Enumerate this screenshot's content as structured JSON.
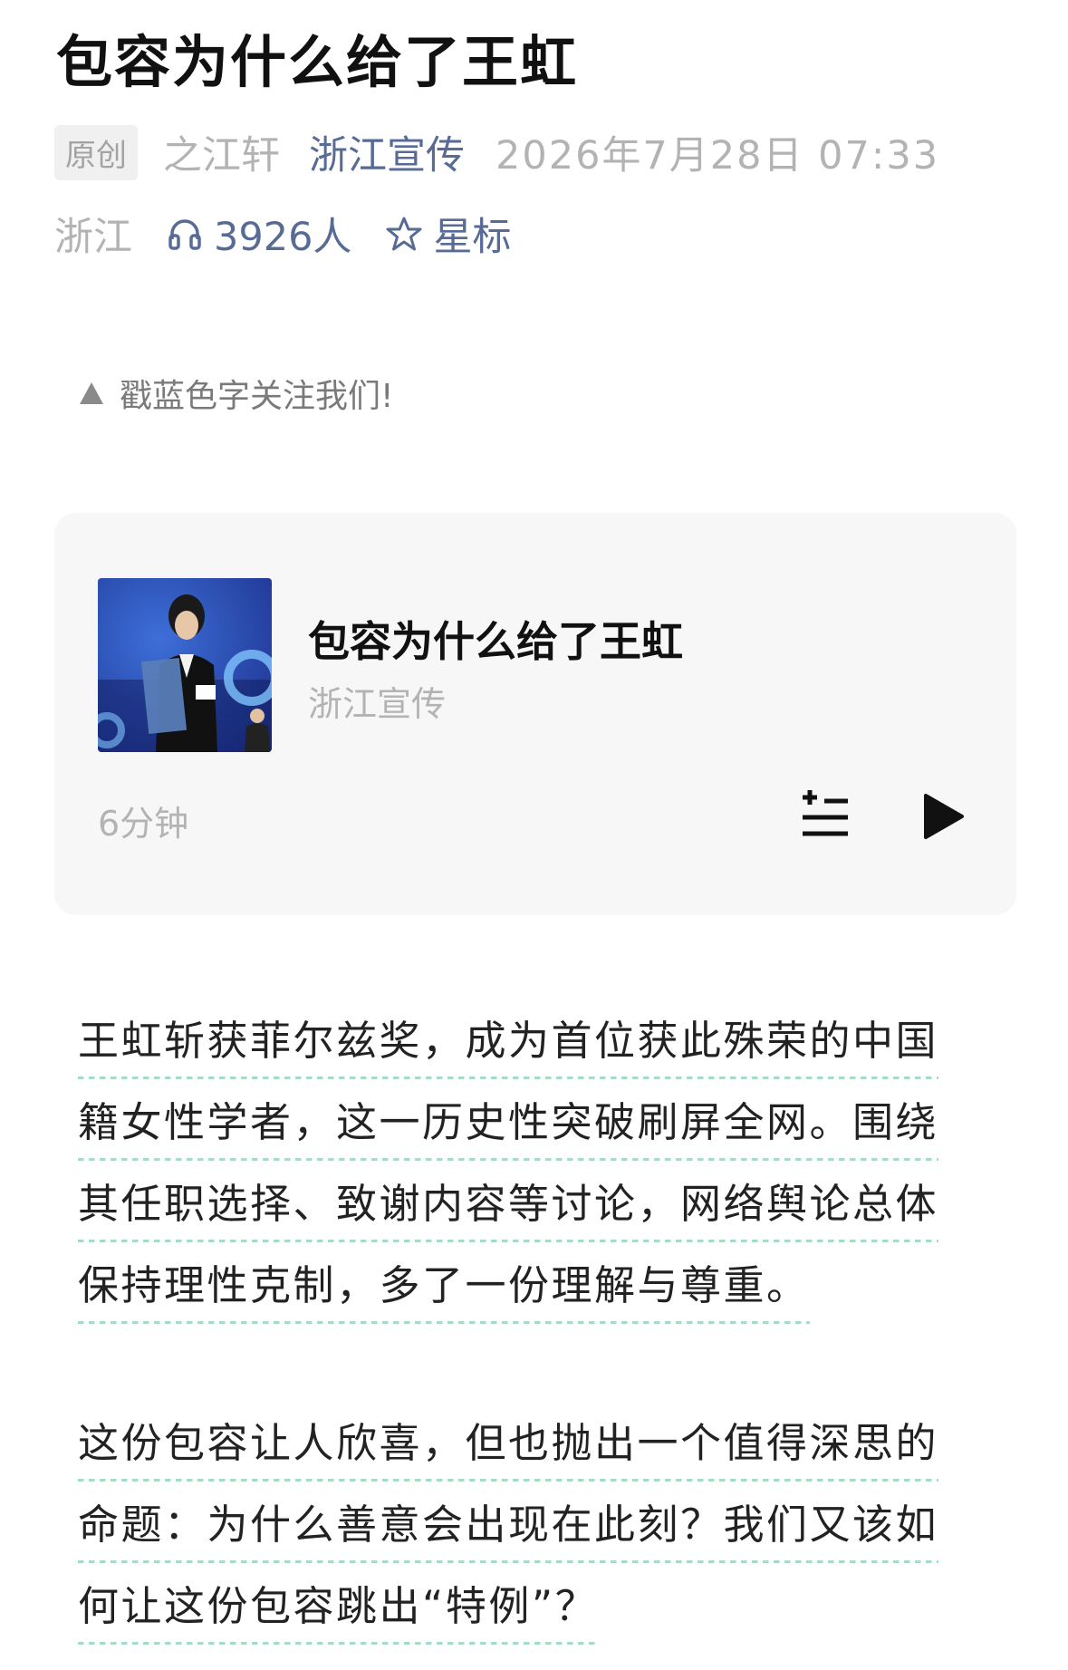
{
  "article": {
    "title": "包容为什么给了王虹",
    "badge": "原创",
    "author": "之江轩",
    "account": "浙江宣传",
    "datetime": "2026年7月28日 07:33",
    "region": "浙江",
    "listeners": "3926人",
    "star_label": "星标",
    "follow_tip": "戳蓝色字关注我们!"
  },
  "audio": {
    "title": "包容为什么给了王虹",
    "source": "浙江宣传",
    "duration": "6分钟"
  },
  "paragraphs": [
    {
      "lines": [
        "王虹斩获菲尔兹奖，成为首位获此殊荣的中国",
        "籍女性学者，这一历史性突破刷屏全网。围绕",
        "其任职选择、致谢内容等讨论，网络舆论总体",
        "保持理性克制，多了一份理解与尊重。"
      ]
    },
    {
      "lines": [
        "这份包容让人欣喜，但也抛出一个值得深思的",
        "命题：为什么善意会出现在此刻？我们又该如",
        "何让这份包容跳出“特例”？"
      ]
    }
  ],
  "colors": {
    "link": "#576b95",
    "muted": "#b3b3b3",
    "underline": "#a6dcc4",
    "card_bg": "#f7f7f7"
  },
  "icons": [
    "headphones-icon",
    "star-icon",
    "triangle-up-icon",
    "playlist-icon",
    "play-icon"
  ]
}
